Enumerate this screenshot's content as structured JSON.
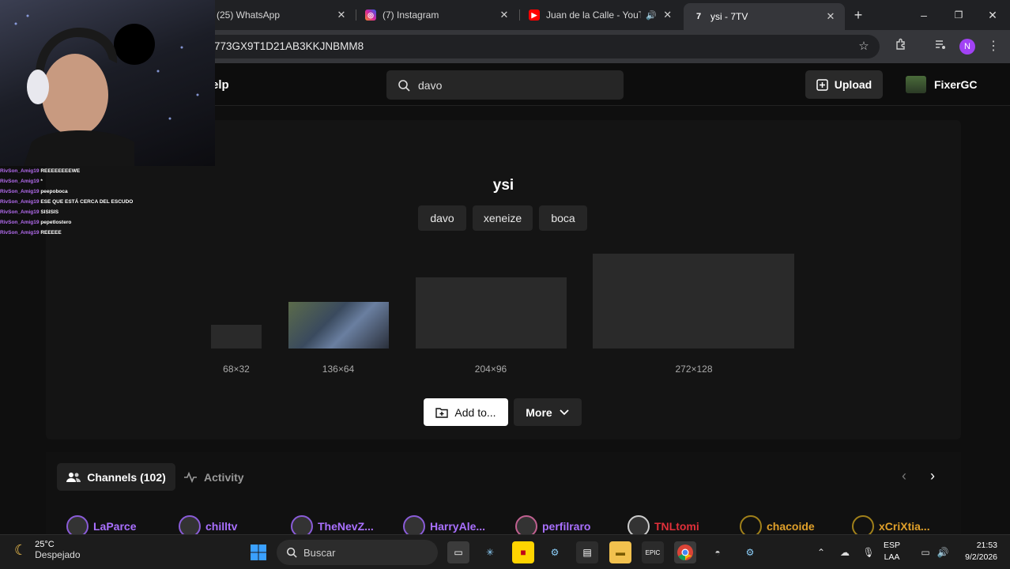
{
  "browser": {
    "tabs": [
      {
        "title": "(25) WhatsApp",
        "favicon": "whatsapp-icon",
        "color": "#25d366"
      },
      {
        "title": "(7) Instagram",
        "favicon": "instagram-icon",
        "color": "#d6249f"
      },
      {
        "title": "Juan de la Calle - YouTube",
        "favicon": "youtube-icon",
        "color": "#ff0000"
      },
      {
        "title": "ysi - 7TV",
        "favicon": "7tv-icon",
        "color": "#ffffff",
        "active": true
      }
    ],
    "new_tab": "+",
    "url": "773GX9T1D21AB3KKJNBMM8",
    "profile_initial": "N",
    "window_controls": {
      "minimize": "–",
      "maximize": "❐",
      "close": "✕"
    }
  },
  "site": {
    "nav_help": "elp",
    "search_value": "davo",
    "upload_label": "Upload",
    "username": "FixerGC"
  },
  "emote": {
    "name": "ysi",
    "tags": [
      "davo",
      "xeneize",
      "boca"
    ],
    "sizes": [
      "68×32",
      "136×64",
      "204×96",
      "272×128"
    ],
    "add_label": "Add to...",
    "more_label": "More"
  },
  "channels": {
    "tab_channels": "Channels (102)",
    "tab_activity": "Activity",
    "list": [
      {
        "name": "LaParce",
        "color": "#a970ff"
      },
      {
        "name": "chilltv",
        "color": "#a970ff"
      },
      {
        "name": "TheNevZ...",
        "color": "#a970ff"
      },
      {
        "name": "HarryAle...",
        "color": "#a970ff"
      },
      {
        "name": "perfilraro",
        "color": "#a970ff"
      },
      {
        "name": "TNLtomi",
        "color": "#e0303a"
      },
      {
        "name": "chacoide",
        "color": "#e0a02a"
      },
      {
        "name": "xCriXtia...",
        "color": "#e0a02a"
      }
    ]
  },
  "stream_chat": [
    {
      "user": "RivSon_Amig19",
      "msg": "REEEEEEEEWE"
    },
    {
      "user": "RivSon_Amig19",
      "msg": "*"
    },
    {
      "user": "RivSon_Amig19",
      "msg": "peepoboca"
    },
    {
      "user": "RivSon_Amig19",
      "msg": "ESE QUE ESTÁ CERCA DEL ESCUDO"
    },
    {
      "user": "RivSon_Amig19",
      "msg": "SISISIS"
    },
    {
      "user": "RivSon_Amig19",
      "msg": "pepetlostero"
    },
    {
      "user": "RivSon_Amig19",
      "msg": "REEEEE"
    }
  ],
  "taskbar": {
    "weather_temp": "25°C",
    "weather_desc": "Despejado",
    "search_placeholder": "Buscar",
    "lang_1": "ESP",
    "lang_2": "LAA",
    "time": "21:53",
    "date": "9/2/2026"
  }
}
